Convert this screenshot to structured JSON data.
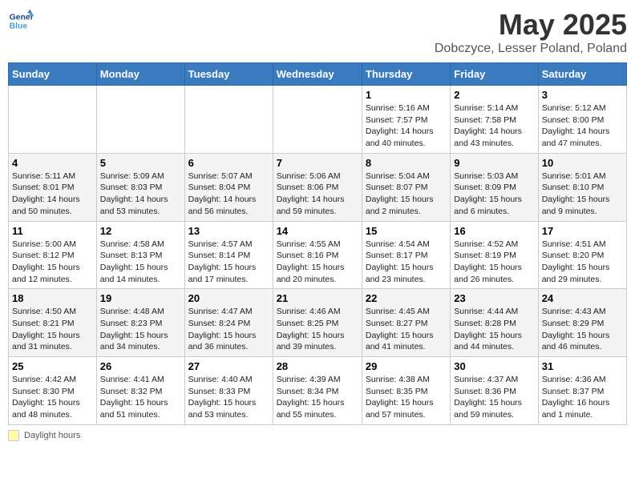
{
  "header": {
    "logo_line1": "General",
    "logo_line2": "Blue",
    "title": "May 2025",
    "subtitle": "Dobczyce, Lesser Poland, Poland"
  },
  "days": [
    "Sunday",
    "Monday",
    "Tuesday",
    "Wednesday",
    "Thursday",
    "Friday",
    "Saturday"
  ],
  "footer": {
    "box_label": "Daylight hours"
  },
  "weeks": [
    [
      {
        "day": "",
        "content": ""
      },
      {
        "day": "",
        "content": ""
      },
      {
        "day": "",
        "content": ""
      },
      {
        "day": "",
        "content": ""
      },
      {
        "day": "1",
        "content": "Sunrise: 5:16 AM\nSunset: 7:57 PM\nDaylight: 14 hours and 40 minutes."
      },
      {
        "day": "2",
        "content": "Sunrise: 5:14 AM\nSunset: 7:58 PM\nDaylight: 14 hours and 43 minutes."
      },
      {
        "day": "3",
        "content": "Sunrise: 5:12 AM\nSunset: 8:00 PM\nDaylight: 14 hours and 47 minutes."
      }
    ],
    [
      {
        "day": "4",
        "content": "Sunrise: 5:11 AM\nSunset: 8:01 PM\nDaylight: 14 hours and 50 minutes."
      },
      {
        "day": "5",
        "content": "Sunrise: 5:09 AM\nSunset: 8:03 PM\nDaylight: 14 hours and 53 minutes."
      },
      {
        "day": "6",
        "content": "Sunrise: 5:07 AM\nSunset: 8:04 PM\nDaylight: 14 hours and 56 minutes."
      },
      {
        "day": "7",
        "content": "Sunrise: 5:06 AM\nSunset: 8:06 PM\nDaylight: 14 hours and 59 minutes."
      },
      {
        "day": "8",
        "content": "Sunrise: 5:04 AM\nSunset: 8:07 PM\nDaylight: 15 hours and 2 minutes."
      },
      {
        "day": "9",
        "content": "Sunrise: 5:03 AM\nSunset: 8:09 PM\nDaylight: 15 hours and 6 minutes."
      },
      {
        "day": "10",
        "content": "Sunrise: 5:01 AM\nSunset: 8:10 PM\nDaylight: 15 hours and 9 minutes."
      }
    ],
    [
      {
        "day": "11",
        "content": "Sunrise: 5:00 AM\nSunset: 8:12 PM\nDaylight: 15 hours and 12 minutes."
      },
      {
        "day": "12",
        "content": "Sunrise: 4:58 AM\nSunset: 8:13 PM\nDaylight: 15 hours and 14 minutes."
      },
      {
        "day": "13",
        "content": "Sunrise: 4:57 AM\nSunset: 8:14 PM\nDaylight: 15 hours and 17 minutes."
      },
      {
        "day": "14",
        "content": "Sunrise: 4:55 AM\nSunset: 8:16 PM\nDaylight: 15 hours and 20 minutes."
      },
      {
        "day": "15",
        "content": "Sunrise: 4:54 AM\nSunset: 8:17 PM\nDaylight: 15 hours and 23 minutes."
      },
      {
        "day": "16",
        "content": "Sunrise: 4:52 AM\nSunset: 8:19 PM\nDaylight: 15 hours and 26 minutes."
      },
      {
        "day": "17",
        "content": "Sunrise: 4:51 AM\nSunset: 8:20 PM\nDaylight: 15 hours and 29 minutes."
      }
    ],
    [
      {
        "day": "18",
        "content": "Sunrise: 4:50 AM\nSunset: 8:21 PM\nDaylight: 15 hours and 31 minutes."
      },
      {
        "day": "19",
        "content": "Sunrise: 4:48 AM\nSunset: 8:23 PM\nDaylight: 15 hours and 34 minutes."
      },
      {
        "day": "20",
        "content": "Sunrise: 4:47 AM\nSunset: 8:24 PM\nDaylight: 15 hours and 36 minutes."
      },
      {
        "day": "21",
        "content": "Sunrise: 4:46 AM\nSunset: 8:25 PM\nDaylight: 15 hours and 39 minutes."
      },
      {
        "day": "22",
        "content": "Sunrise: 4:45 AM\nSunset: 8:27 PM\nDaylight: 15 hours and 41 minutes."
      },
      {
        "day": "23",
        "content": "Sunrise: 4:44 AM\nSunset: 8:28 PM\nDaylight: 15 hours and 44 minutes."
      },
      {
        "day": "24",
        "content": "Sunrise: 4:43 AM\nSunset: 8:29 PM\nDaylight: 15 hours and 46 minutes."
      }
    ],
    [
      {
        "day": "25",
        "content": "Sunrise: 4:42 AM\nSunset: 8:30 PM\nDaylight: 15 hours and 48 minutes."
      },
      {
        "day": "26",
        "content": "Sunrise: 4:41 AM\nSunset: 8:32 PM\nDaylight: 15 hours and 51 minutes."
      },
      {
        "day": "27",
        "content": "Sunrise: 4:40 AM\nSunset: 8:33 PM\nDaylight: 15 hours and 53 minutes."
      },
      {
        "day": "28",
        "content": "Sunrise: 4:39 AM\nSunset: 8:34 PM\nDaylight: 15 hours and 55 minutes."
      },
      {
        "day": "29",
        "content": "Sunrise: 4:38 AM\nSunset: 8:35 PM\nDaylight: 15 hours and 57 minutes."
      },
      {
        "day": "30",
        "content": "Sunrise: 4:37 AM\nSunset: 8:36 PM\nDaylight: 15 hours and 59 minutes."
      },
      {
        "day": "31",
        "content": "Sunrise: 4:36 AM\nSunset: 8:37 PM\nDaylight: 16 hours and 1 minute."
      }
    ]
  ]
}
